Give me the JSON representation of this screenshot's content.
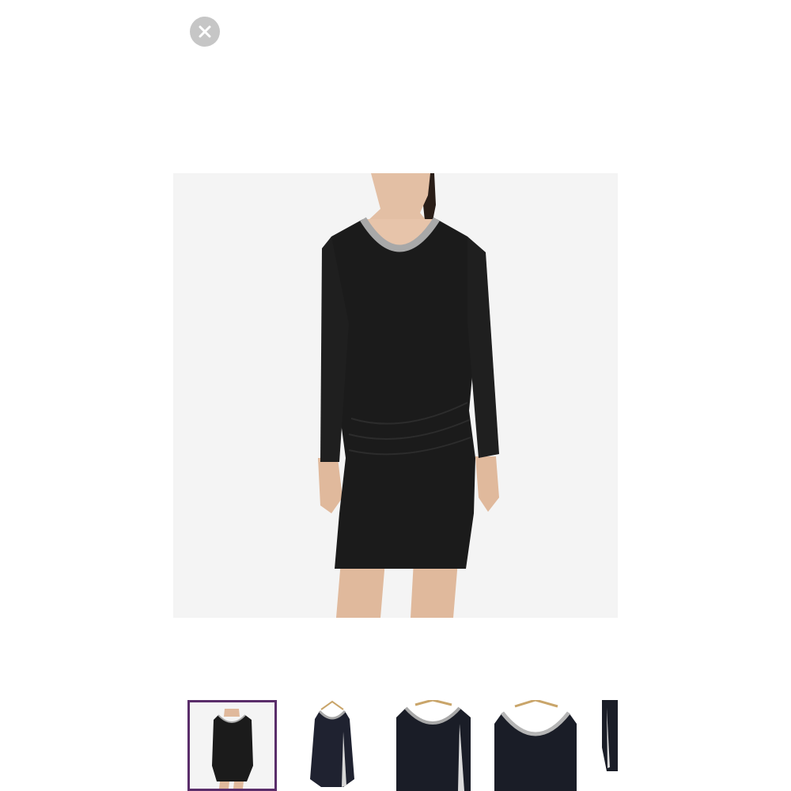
{
  "viewer": {
    "close_icon": "close-icon",
    "main_image_alt": "",
    "thumbnails": [
      {
        "id": 1,
        "selected": true
      },
      {
        "id": 2,
        "selected": false
      },
      {
        "id": 3,
        "selected": false
      },
      {
        "id": 4,
        "selected": false
      },
      {
        "id": 5,
        "selected": false
      }
    ]
  },
  "colors": {
    "accent_selected_border": "#5a2d6a",
    "close_bg": "#c6c6c6",
    "dress": "#1b1b1b",
    "neck_trim": "#a8a8a8",
    "skin": "#e8c6ad"
  }
}
